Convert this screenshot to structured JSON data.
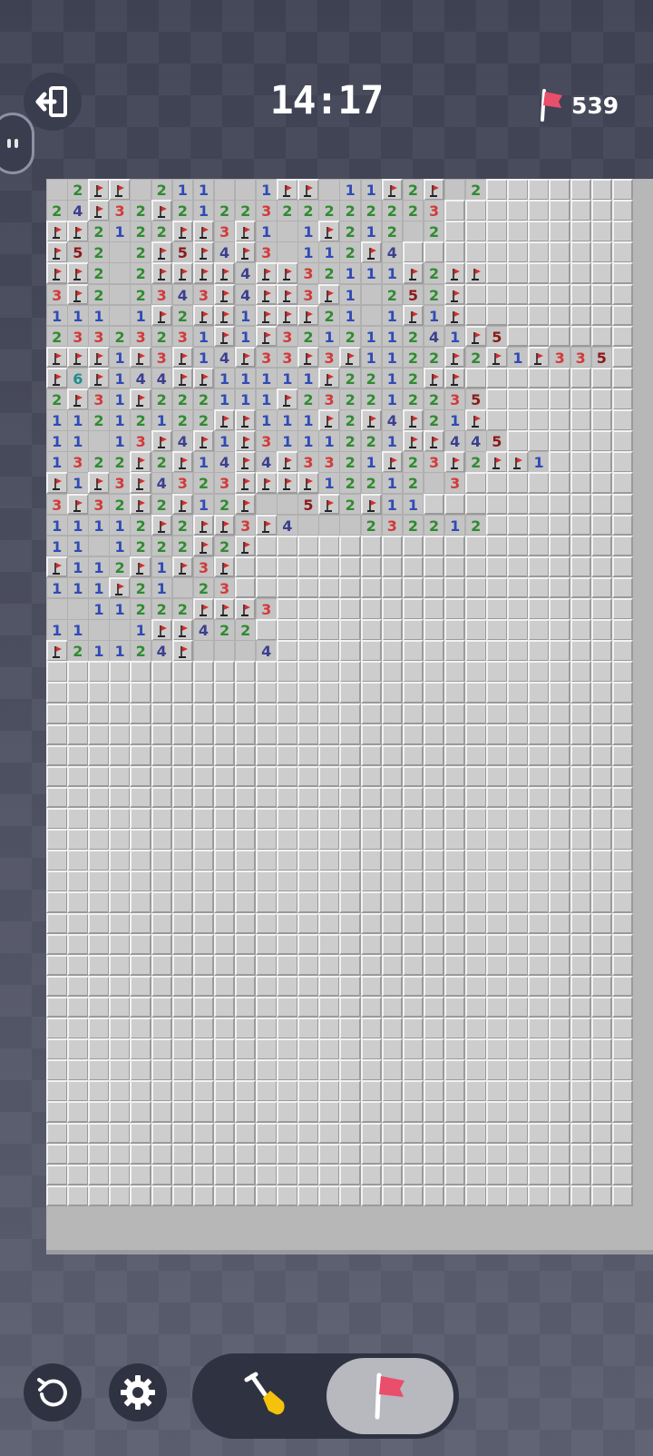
{
  "header": {
    "timer": "14:17",
    "flags_remaining": "539"
  },
  "icons": {
    "exit": "exit-icon",
    "side": "side-peek-icon",
    "flag": "flag-icon",
    "restart": "restart-icon",
    "settings": "gear-icon",
    "dig": "shovel-icon",
    "flag_mode": "flag-icon"
  },
  "colors": {
    "n1": "#2f4bb6",
    "n2": "#2f8b2f",
    "n3": "#d33a3a",
    "n4": "#3c3f8f",
    "n5": "#8b1a1a",
    "n6": "#1f8c8c",
    "flag": "#e94e6b"
  },
  "controls": {
    "active_mode": "flag"
  },
  "board": {
    "columns": 28,
    "rows": 49,
    "revealed_rows": [
      "_2FF_211__1FF_11F2F_2",
      "24F32F2122322222223",
      "FF2122FF3F1_1F212_2",
      "F52_2F5F4F3_112F4",
      "FF2_2FFFF4FF32111F2FF",
      "3F2_2343F4FF3F1_252F",
      "111_1F2FF1FFF21_1F1F",
      "23323231F1F321211241F5",
      "FFF1F3F14F33F3F1122F2F1F335",
      "F6F144FF11111F2212FF",
      "2F31F222111F232212235",
      "11212122FF111F2F4F21F",
      "11_13F4F1F3111221FF445",
      "1322F2F14F4F3321F23F2FF1",
      "F1F3F4323FFFF12212_3",
      "3F32F2F12F__5F2F11",
      "11112F2FF3F4___232212",
      "11_1222F2F",
      "F112F1F3F",
      "111F21_23",
      "__11222FFF3",
      "11__1FF422",
      "F21124F___4"
    ]
  }
}
